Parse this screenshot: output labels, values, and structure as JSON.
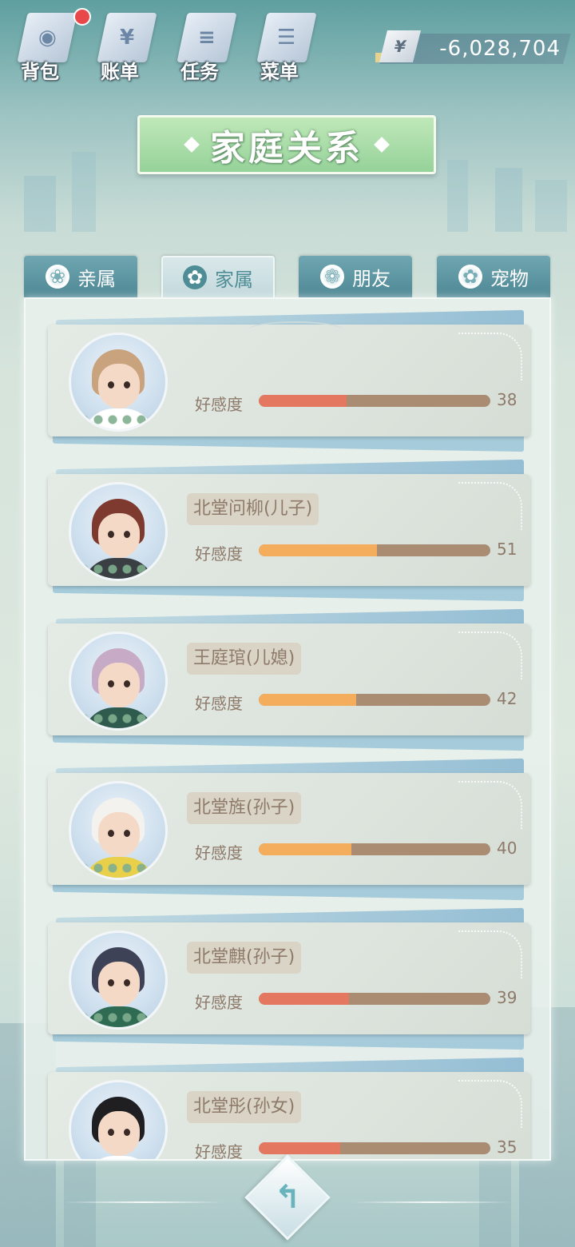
{
  "nav": {
    "items": [
      {
        "label": "背包",
        "icon": "backpack-icon",
        "glyph": "◉",
        "badge": true
      },
      {
        "label": "账单",
        "icon": "bill-icon",
        "glyph": "¥",
        "badge": false
      },
      {
        "label": "任务",
        "icon": "task-icon",
        "glyph": "≡",
        "badge": false
      },
      {
        "label": "菜单",
        "icon": "menu-icon",
        "glyph": "☰",
        "badge": false
      }
    ]
  },
  "money": {
    "symbol": "¥",
    "value": "-6,028,704"
  },
  "title": "家庭关系",
  "tabs": [
    {
      "label": "亲属",
      "glyph": "❀",
      "active": false
    },
    {
      "label": "家属",
      "glyph": "✿",
      "active": true
    },
    {
      "label": "朋友",
      "glyph": "❁",
      "active": false
    },
    {
      "label": "宠物",
      "glyph": "✿",
      "active": false
    }
  ],
  "affinity_label": "好感度",
  "members": [
    {
      "name": "",
      "value": 38,
      "bar_color": "#e37760",
      "hair": "#c9a27e",
      "shirt": "#ffffff"
    },
    {
      "name": "北堂问柳(儿子)",
      "value": 51,
      "bar_color": "#f4ad5c",
      "hair": "#7e3a2e",
      "shirt": "#3a3f44"
    },
    {
      "name": "王庭琯(儿媳)",
      "value": 42,
      "bar_color": "#f4ad5c",
      "hair": "#c7aac6",
      "shirt": "#2f5a4e"
    },
    {
      "name": "北堂旌(孙子)",
      "value": 40,
      "bar_color": "#f4ad5c",
      "hair": "#f4f2ef",
      "shirt": "#e8d04a"
    },
    {
      "name": "北堂麒(孙子)",
      "value": 39,
      "bar_color": "#e37760",
      "hair": "#3d4256",
      "shirt": "#2f6b52"
    },
    {
      "name": "北堂彤(孙女)",
      "value": 35,
      "bar_color": "#e37760",
      "hair": "#1f1f22",
      "shirt": "#ffffff"
    }
  ],
  "back_glyph": "↰"
}
